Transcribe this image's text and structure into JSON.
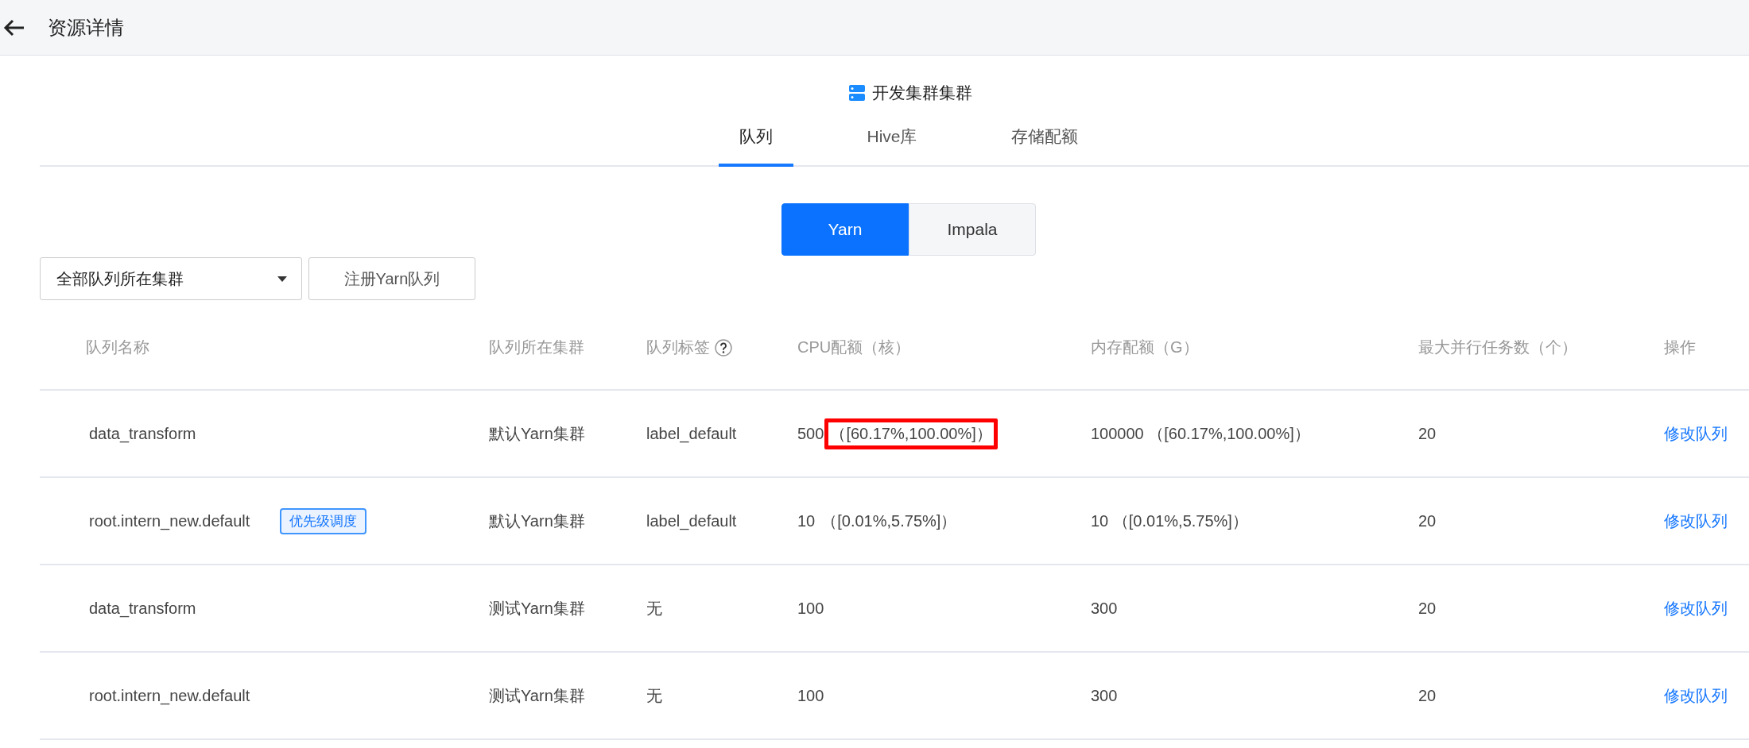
{
  "header": {
    "title": "资源详情"
  },
  "cluster": {
    "name": "开发集群集群"
  },
  "tabs": [
    {
      "label": "队列",
      "selected": true
    },
    {
      "label": "Hive库",
      "selected": false
    },
    {
      "label": "存储配额",
      "selected": false
    }
  ],
  "engine_switch": [
    {
      "label": "Yarn",
      "selected": true
    },
    {
      "label": "Impala",
      "selected": false
    }
  ],
  "toolbar": {
    "cluster_select": "全部队列所在集群",
    "register_button": "注册Yarn队列"
  },
  "table": {
    "columns": [
      "队列名称",
      "队列所在集群",
      "队列标签",
      "CPU配额（核）",
      "内存配额（G）",
      "最大并行任务数（个）",
      "操作"
    ],
    "rows": [
      {
        "name": "data_transform",
        "cluster": "默认Yarn集群",
        "label": "label_default",
        "cpu": {
          "value": "500",
          "range": "（[60.17%,100.00%]）",
          "highlighted": true
        },
        "memory": "100000 （[60.17%,100.00%]）",
        "max_tasks": "20",
        "action": "修改队列"
      },
      {
        "name": "root.intern_new.default",
        "tag": "优先级调度",
        "cluster": "默认Yarn集群",
        "label": "label_default",
        "cpu": {
          "value": "10",
          "range": "（[0.01%,5.75%]）",
          "highlighted": false
        },
        "memory": "10 （[0.01%,5.75%]）",
        "max_tasks": "20",
        "action": "修改队列"
      },
      {
        "name": "data_transform",
        "cluster": "测试Yarn集群",
        "label": "无",
        "cpu": {
          "value": "100"
        },
        "memory": "300",
        "max_tasks": "20",
        "action": "修改队列"
      },
      {
        "name": "root.intern_new.default",
        "cluster": "测试Yarn集群",
        "label": "无",
        "cpu": {
          "value": "100"
        },
        "memory": "300",
        "max_tasks": "20",
        "action": "修改队列"
      }
    ]
  }
}
